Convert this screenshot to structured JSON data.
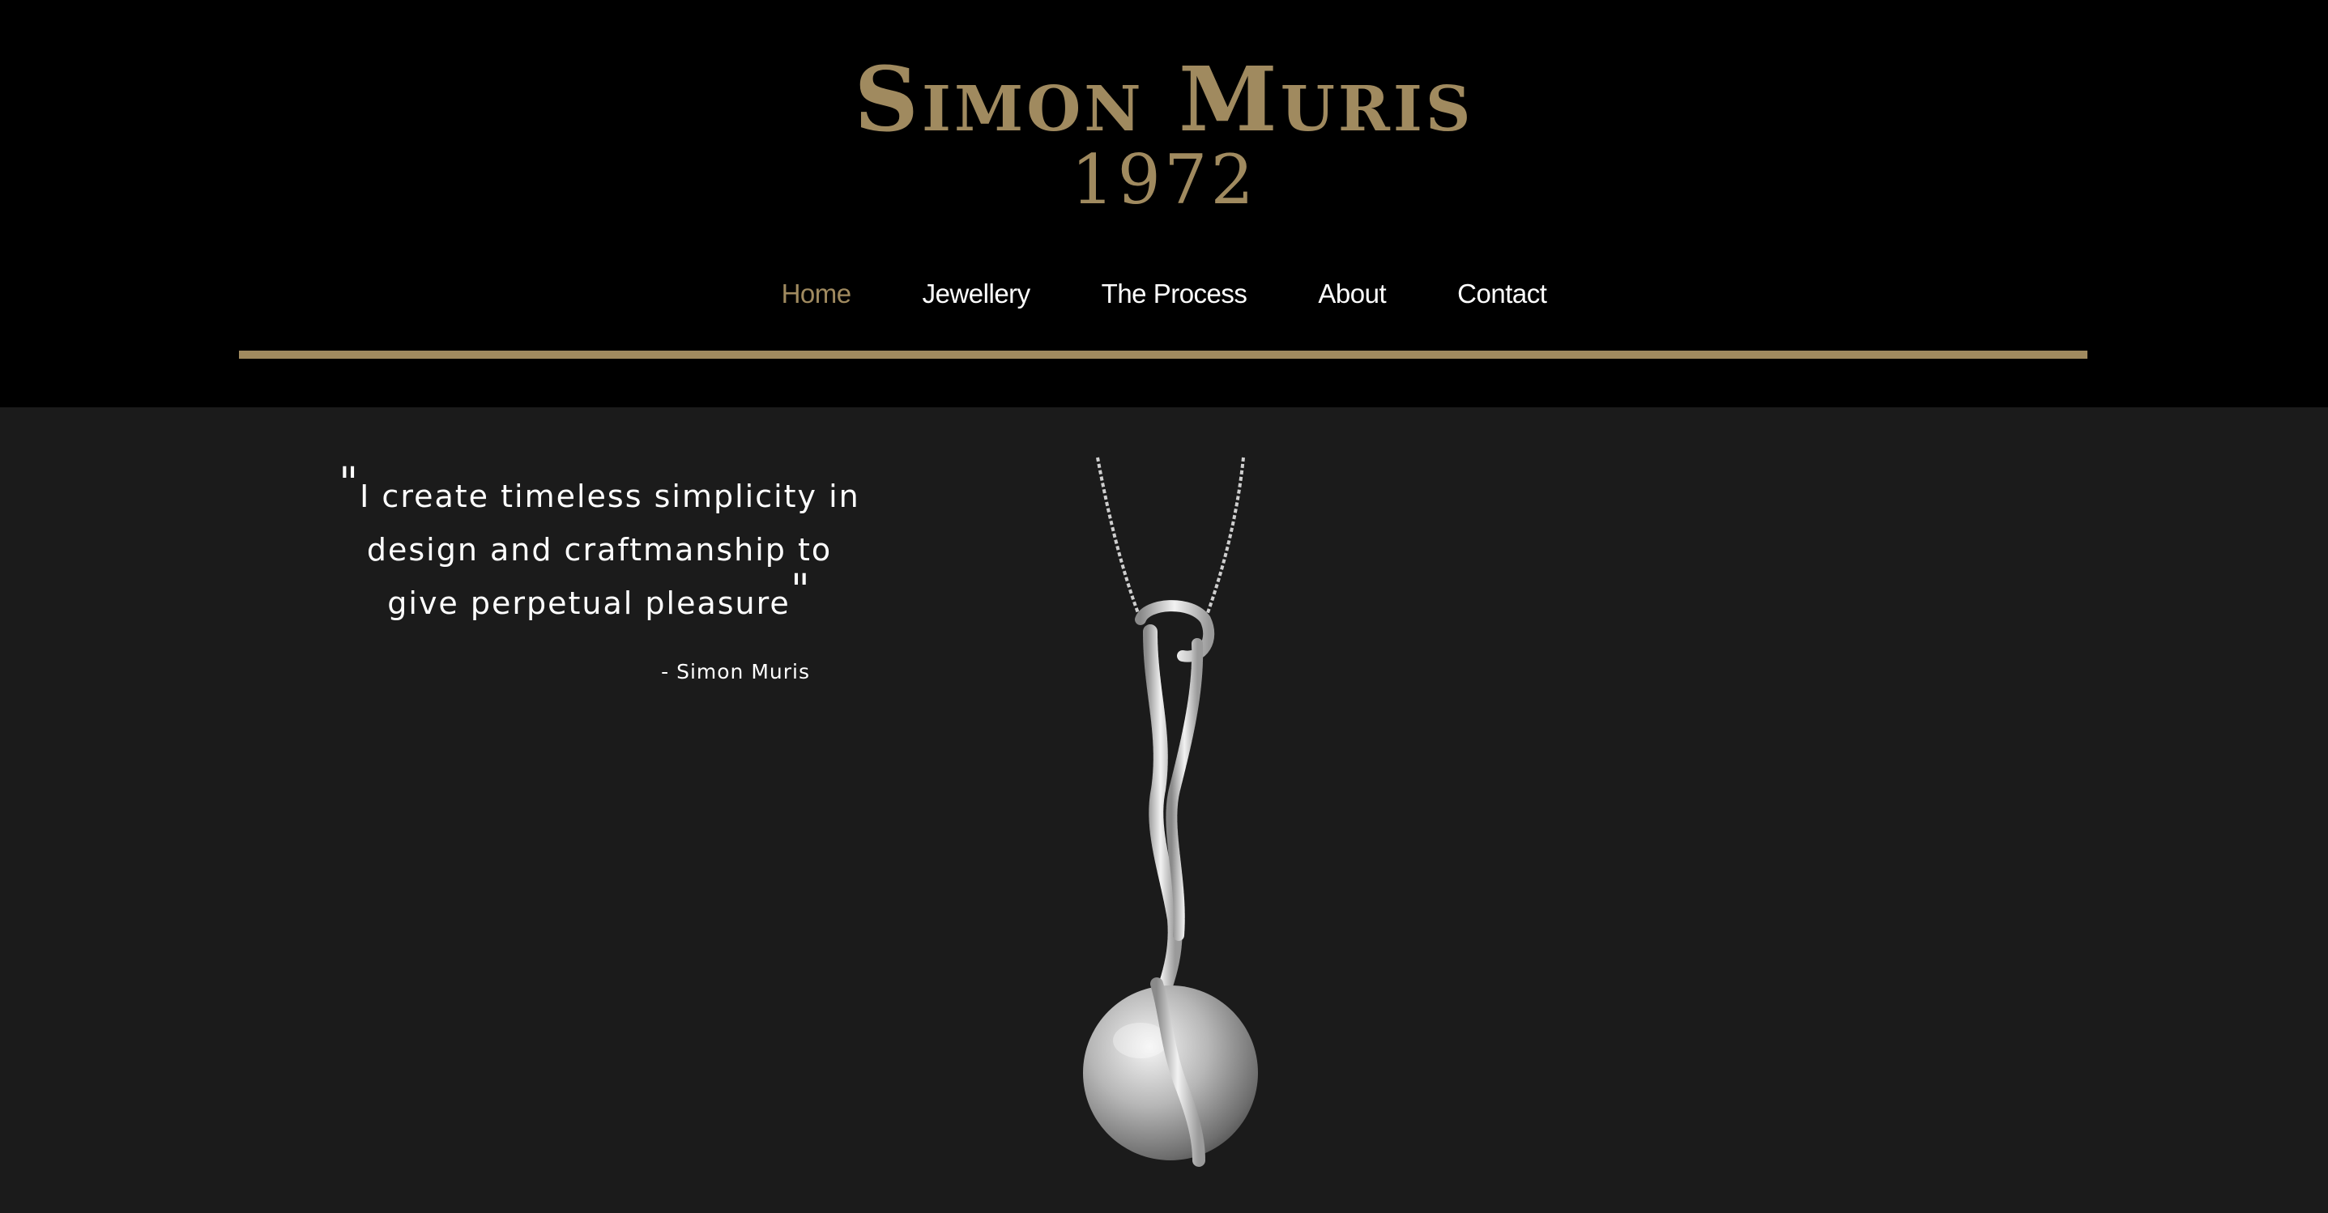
{
  "brand": {
    "name": "Simon Muris",
    "year": "1972"
  },
  "nav": {
    "items": [
      {
        "label": "Home",
        "active": true
      },
      {
        "label": "Jewellery",
        "active": false
      },
      {
        "label": "The Process",
        "active": false
      },
      {
        "label": "About",
        "active": false
      },
      {
        "label": "Contact",
        "active": false
      }
    ]
  },
  "quote": {
    "open_mark": "\"",
    "line1": "I create timeless simplicity in",
    "line2": "design and craftmanship to",
    "line3": "give perpetual pleasure",
    "close_mark": "\"",
    "attribution": "- Simon Muris"
  },
  "colors": {
    "accent": "#a08a5f",
    "header_bg": "#000000",
    "body_bg": "#1b1b1b",
    "text": "#ffffff"
  },
  "hero_image": {
    "icon": "pearl-pendant-icon"
  }
}
